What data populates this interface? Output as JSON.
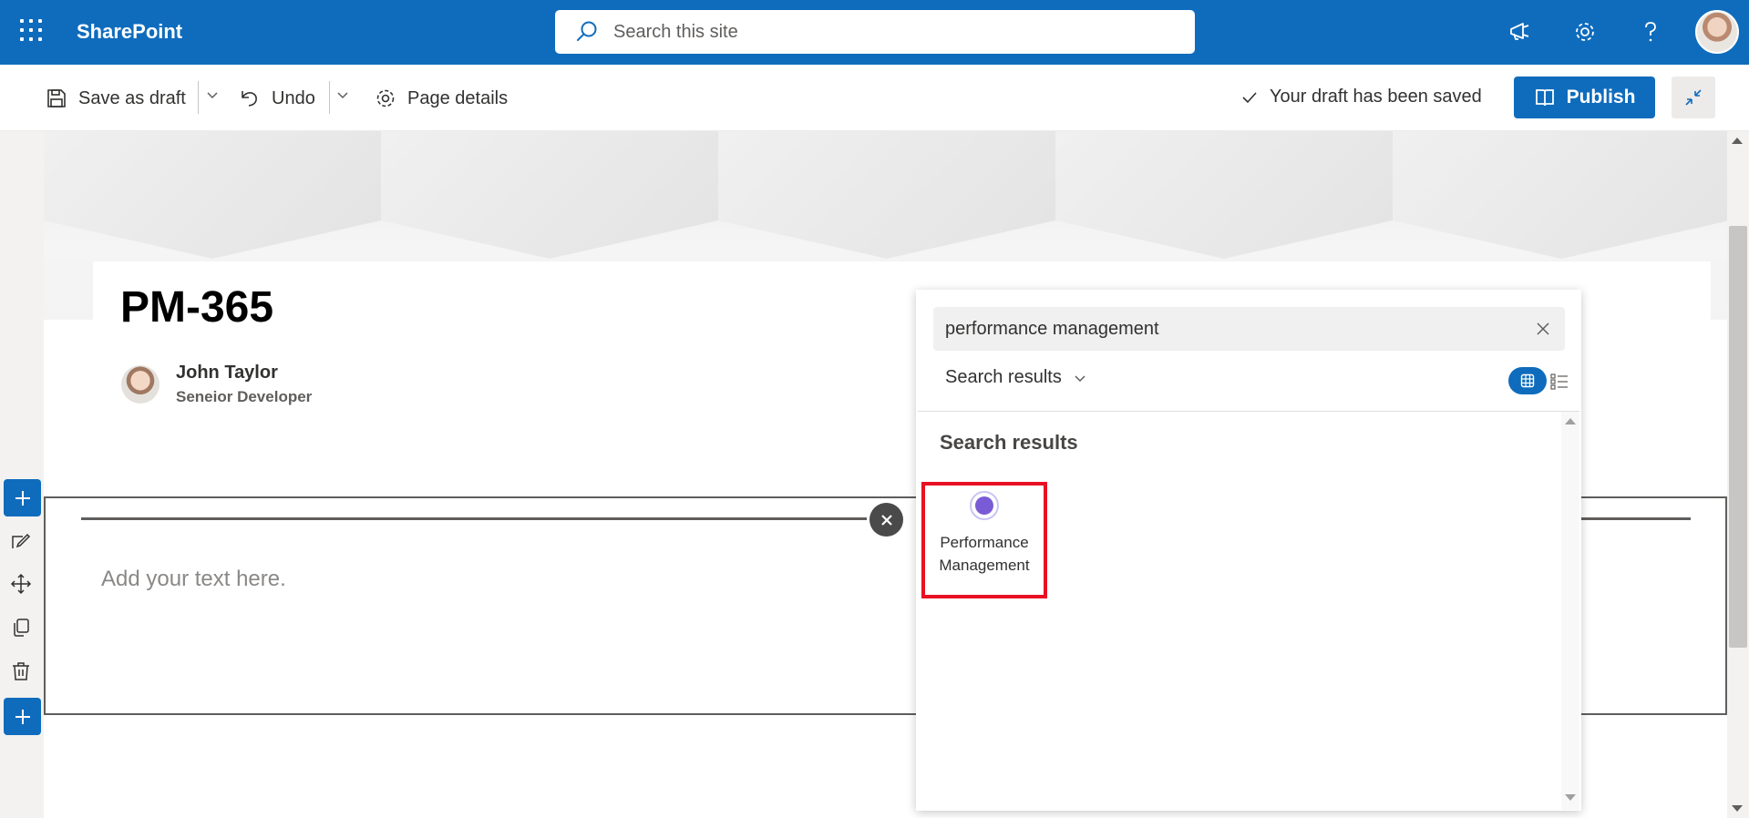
{
  "suite_bar": {
    "app_name": "SharePoint",
    "search_placeholder": "Search this site",
    "icons": [
      "waffle-icon",
      "megaphone-icon",
      "settings-gear-icon",
      "help-icon",
      "user-avatar"
    ]
  },
  "command_bar": {
    "save_as_draft": "Save as draft",
    "undo": "Undo",
    "page_details": "Page details",
    "status": "Your draft has been saved",
    "publish": "Publish"
  },
  "page": {
    "title": "PM-365",
    "author_name": "John Taylor",
    "author_role": "Seneior Developer",
    "text_placeholder": "Add your text here."
  },
  "picker": {
    "search_value": "performance management",
    "dropdown_label": "Search results",
    "results_heading": "Search results",
    "results": [
      {
        "label_line1": "Performance",
        "label_line2": "Management"
      }
    ]
  },
  "colors": {
    "brand_blue": "#0f6cbd",
    "highlight_red": "#e81123"
  }
}
